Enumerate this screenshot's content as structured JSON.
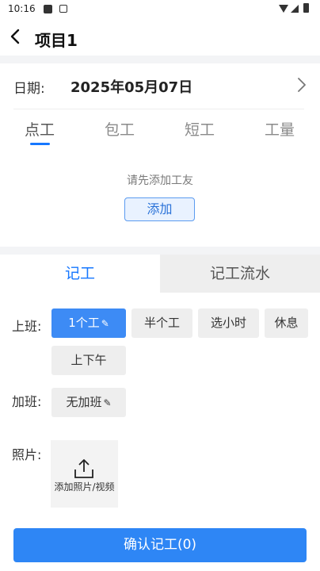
{
  "status_bar": {
    "time": "10:16"
  },
  "header": {
    "title": "项目1"
  },
  "date": {
    "label": "日期:",
    "value": "2025年05月07日"
  },
  "work_types": [
    "点工",
    "包工",
    "短工",
    "工量"
  ],
  "workers": {
    "hint": "请先添加工友",
    "add_label": "添加"
  },
  "record_tabs": {
    "active": "记工",
    "other": "记工流水"
  },
  "shift": {
    "label": "上班:",
    "options": [
      "1个工",
      "半个工",
      "选小时",
      "休息",
      "上下午"
    ],
    "selected": "1个工"
  },
  "overtime": {
    "label": "加班:",
    "value": "无加班"
  },
  "photo": {
    "label": "照片:",
    "add_label": "添加照片/视频"
  },
  "confirm": {
    "label": "确认记工(0)"
  },
  "colors": {
    "accent": "#1677ff",
    "button": "#2e86f5"
  }
}
